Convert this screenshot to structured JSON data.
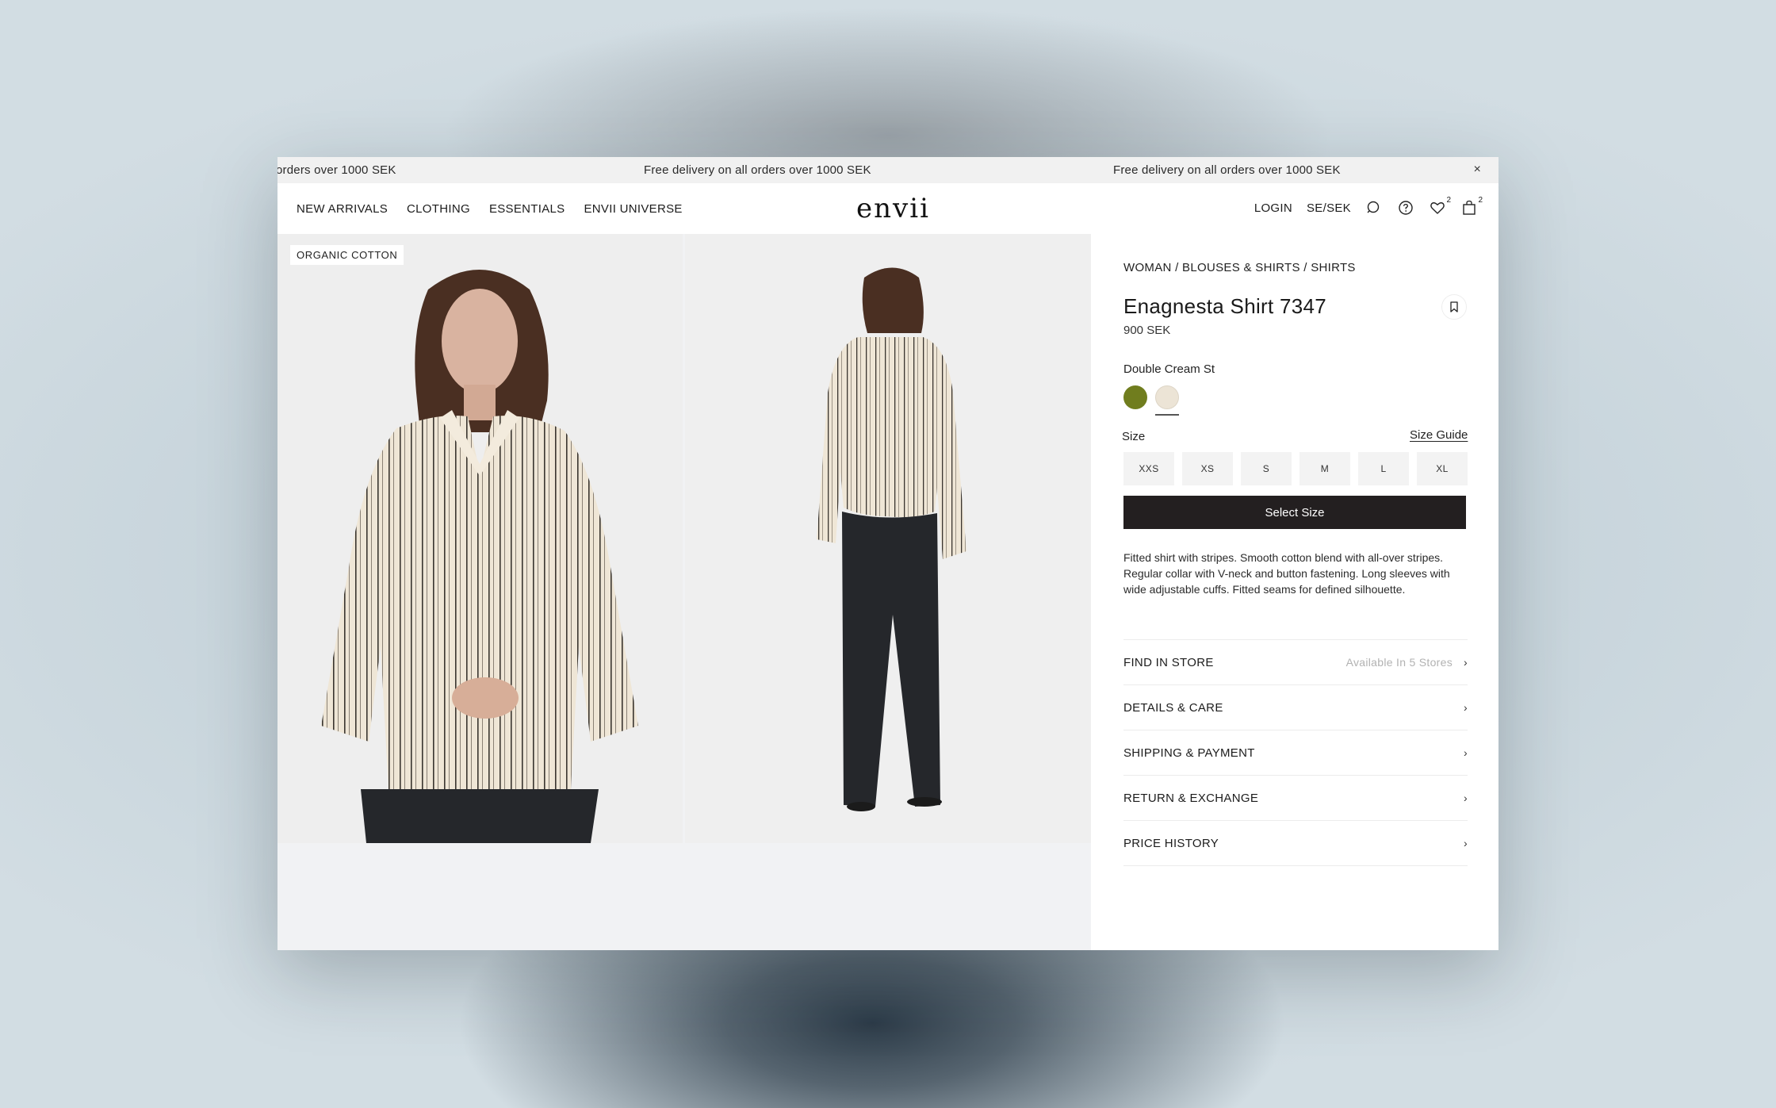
{
  "announcement": {
    "messages": [
      "orders over 1000 SEK",
      "Free delivery on all orders over 1000 SEK",
      "Free delivery on all orders over 1000 SEK"
    ],
    "close_icon": "×"
  },
  "header": {
    "nav": [
      "NEW ARRIVALS",
      "CLOTHING",
      "ESSENTIALS",
      "ENVII UNIVERSE"
    ],
    "logo": "envii",
    "login": "LOGIN",
    "locale": "SE/SEK",
    "wishlist_count": "2",
    "cart_count": "2"
  },
  "gallery": {
    "tag": "ORGANIC COTTON"
  },
  "product": {
    "breadcrumb": "WOMAN / BLOUSES & SHIRTS / SHIRTS",
    "title": "Enagnesta Shirt 7347",
    "price": "900 SEK",
    "color_name": "Double Cream St",
    "swatches": [
      {
        "name": "green",
        "color": "#707d1e"
      },
      {
        "name": "double-cream",
        "color": "#ece4d6",
        "selected": true
      }
    ],
    "size_label": "Size",
    "size_guide": "Size Guide",
    "sizes": [
      "XXS",
      "XS",
      "S",
      "M",
      "L",
      "XL"
    ],
    "select_button": "Select Size",
    "description": "Fitted shirt with stripes. Smooth cotton blend with all-over stripes. Regular collar with V-neck and button fastening. Long sleeves with wide adjustable cuffs. Fitted seams for defined silhouette.",
    "accordion": [
      {
        "label": "FIND IN STORE",
        "meta": "Available In 5 Stores"
      },
      {
        "label": "DETAILS & CARE",
        "meta": ""
      },
      {
        "label": "SHIPPING & PAYMENT",
        "meta": ""
      },
      {
        "label": "RETURN & EXCHANGE",
        "meta": ""
      },
      {
        "label": "PRICE HISTORY",
        "meta": ""
      }
    ]
  },
  "colors": {
    "button_bg": "#231f20",
    "gallery_bg": "#f1f2f4"
  }
}
